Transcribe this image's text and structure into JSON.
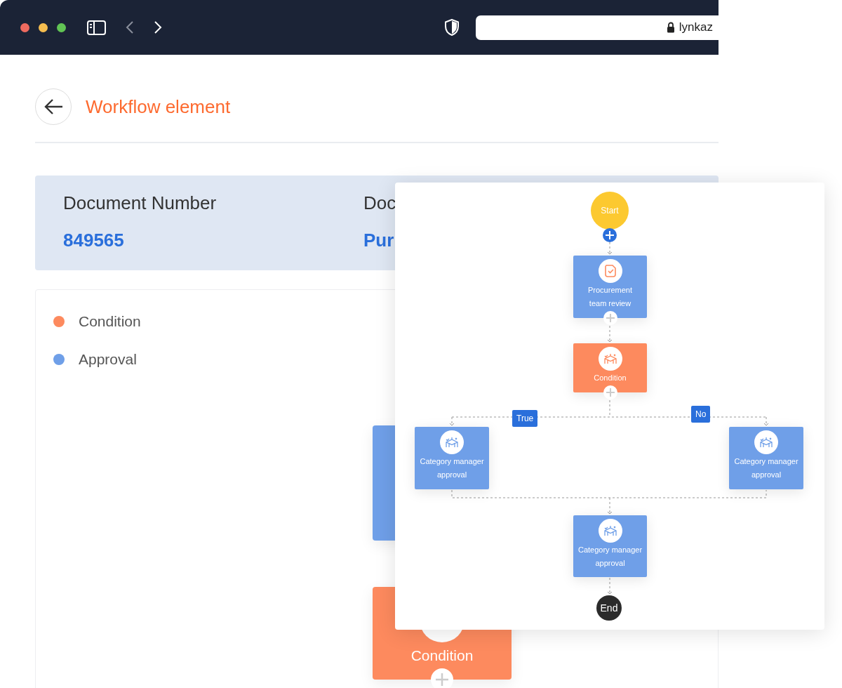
{
  "browser": {
    "url": "lynkaz"
  },
  "page": {
    "title": "Workflow element"
  },
  "document": {
    "fields": [
      {
        "label": "Document Number",
        "value": "849565"
      },
      {
        "label": "Doc",
        "value": "Pur"
      }
    ]
  },
  "legend": [
    {
      "label": "Condition",
      "color": "#fd8a5e"
    },
    {
      "label": "Approval",
      "color": "#6f9fe8"
    }
  ],
  "background_nodes": [
    {
      "kind": "approval"
    },
    {
      "kind": "condition",
      "label": "Condition"
    }
  ],
  "diagram": {
    "nodes": [
      {
        "kind": "start",
        "label": "Start",
        "add_button": {
          "highlighted": true
        }
      },
      {
        "kind": "task",
        "lines": [
          "Procurement",
          "team review"
        ],
        "add_button": {
          "highlighted": false
        }
      },
      {
        "kind": "condition",
        "lines": [
          "Condition"
        ],
        "add_button": {
          "highlighted": false
        }
      },
      {
        "kind": "approval",
        "lines": [
          "Category manager",
          "approval"
        ]
      },
      {
        "kind": "approval",
        "lines": [
          "Category manager",
          "approval"
        ]
      },
      {
        "kind": "approval",
        "lines": [
          "Category manager",
          "approval"
        ]
      },
      {
        "kind": "end",
        "label": "End"
      }
    ],
    "branch_labels": [
      "True",
      "No"
    ]
  }
}
